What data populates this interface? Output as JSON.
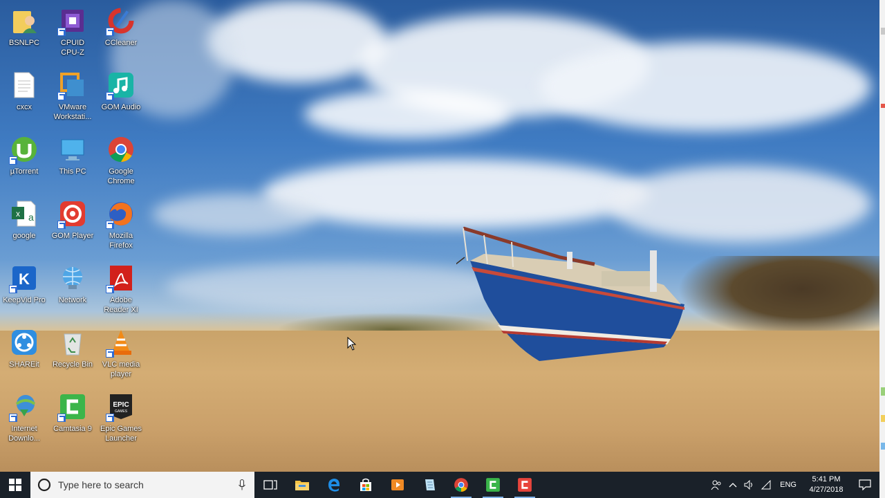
{
  "desktop": {
    "icons": [
      {
        "label": "BSNLPC",
        "icon": "user-folder-icon"
      },
      {
        "label": "CPUID\nCPU-Z",
        "icon": "cpu-z-icon"
      },
      {
        "label": "CCleaner",
        "icon": "ccleaner-icon"
      },
      {
        "label": "cxcx",
        "icon": "text-file-icon"
      },
      {
        "label": "VMware\nWorkstati...",
        "icon": "vmware-icon"
      },
      {
        "label": "GOM Audio",
        "icon": "gom-audio-icon"
      },
      {
        "label": "µTorrent",
        "icon": "utorrent-icon"
      },
      {
        "label": "This PC",
        "icon": "this-pc-icon"
      },
      {
        "label": "Google\nChrome",
        "icon": "chrome-icon"
      },
      {
        "label": "google",
        "icon": "excel-file-icon"
      },
      {
        "label": "GOM Player",
        "icon": "gom-player-icon"
      },
      {
        "label": "Mozilla\nFirefox",
        "icon": "firefox-icon"
      },
      {
        "label": "KeepVid Pro",
        "icon": "keepvid-icon"
      },
      {
        "label": "Network",
        "icon": "network-icon"
      },
      {
        "label": "Adobe\nReader XI",
        "icon": "adobe-reader-icon"
      },
      {
        "label": "SHAREit",
        "icon": "shareit-icon"
      },
      {
        "label": "Recycle Bin",
        "icon": "recycle-bin-icon"
      },
      {
        "label": "VLC media\nplayer",
        "icon": "vlc-icon"
      },
      {
        "label": "Internet\nDownlo...",
        "icon": "idm-icon"
      },
      {
        "label": "Camtasia 9",
        "icon": "camtasia-icon"
      },
      {
        "label": "Epic Games\nLauncher",
        "icon": "epic-games-icon"
      }
    ]
  },
  "taskbar": {
    "search_placeholder": "Type here to search",
    "pinned": [
      "task-view-icon",
      "file-explorer-icon",
      "edge-icon",
      "store-icon",
      "media-player-icon",
      "notes-icon",
      "chrome-icon",
      "camtasia-icon",
      "camtasia-recorder-icon"
    ],
    "language": "ENG",
    "time": "5:41 PM",
    "date": "4/27/2018"
  },
  "colors": {
    "taskbar_bg": "#181c22",
    "accent": "#7fb2e8"
  }
}
